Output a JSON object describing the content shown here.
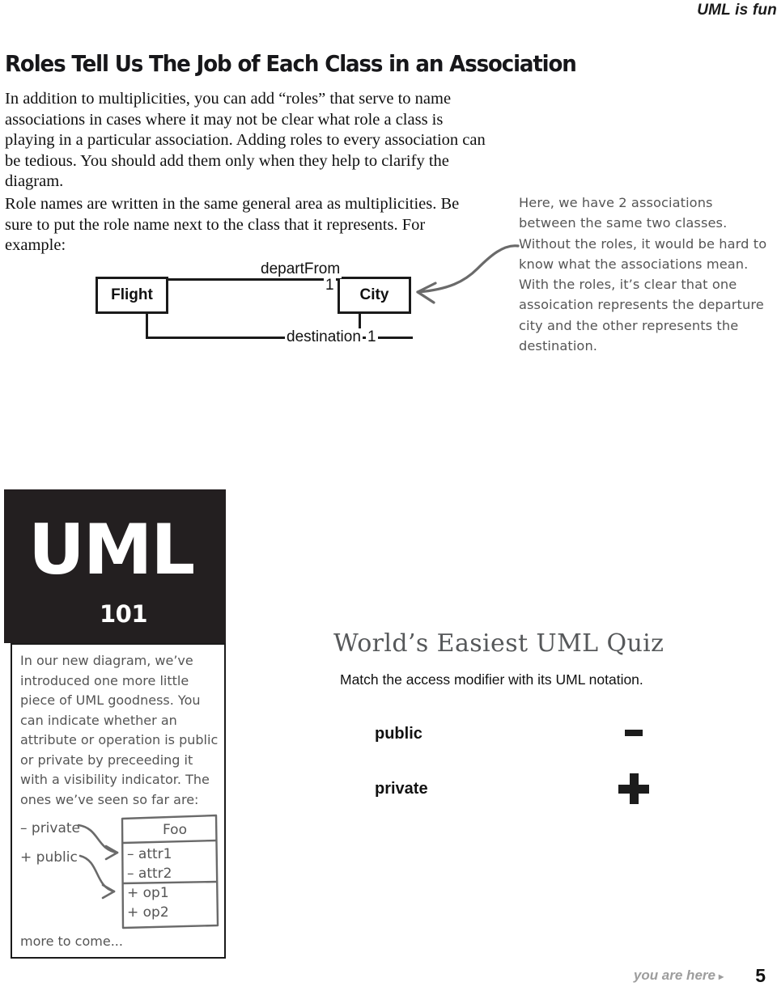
{
  "running_head": "UML is fun",
  "section": {
    "heading": "Roles Tell Us The Job of Each Class in an Association",
    "paragraph_1": "In addition to multiplicities, you can add “roles” that serve to name associations in cases where it may not be clear what role a class is playing in a particular association.  Adding roles to every association can be tedious.  You should add them only when they help to clarify the diagram.",
    "paragraph_2": "Role names are written in the same general area as multiplicities.  Be sure to put the role name next to the class that it represents.  For example:"
  },
  "class_diagram": {
    "classes": [
      {
        "name": "Flight"
      },
      {
        "name": "City"
      }
    ],
    "associations": [
      {
        "role": "departFrom",
        "multiplicity": "1"
      },
      {
        "role": "destination",
        "multiplicity": "1"
      }
    ]
  },
  "callout": {
    "text": "Here, we have 2 associations between the same two classes.  Without the roles, it would be hard to know what the associations mean.  With the roles, it’s clear that one assoication represents the departure city and the other represents the destination."
  },
  "uml101": {
    "wordmark": "UML",
    "subtitle": "101",
    "note": "In our new diagram, we’ve introduced one more little piece of UML goodness.  You can indicate whether an attribute or operation is public or private by preceeding it with a visibility indicator.  The ones we’ve seen so far are:",
    "legend": [
      {
        "symbol": "–",
        "label": "private"
      },
      {
        "symbol": "+",
        "label": "public"
      }
    ],
    "legend_private": "– private",
    "legend_public": "+ public",
    "more_to_come": "more to come...",
    "foo_class": {
      "name": "Foo",
      "attributes": [
        "– attr1",
        "– attr2"
      ],
      "operations": [
        "+ op1",
        "+ op2"
      ]
    }
  },
  "quiz": {
    "title": "World’s Easiest UML Quiz",
    "instruction": "Match the access modifier with its UML notation.",
    "items": [
      {
        "term": "public",
        "symbol": "-"
      },
      {
        "term": "private",
        "symbol": "+"
      }
    ]
  },
  "footer": {
    "you_are_here": "you are here",
    "arrow": "▸",
    "page_number": "5"
  }
}
